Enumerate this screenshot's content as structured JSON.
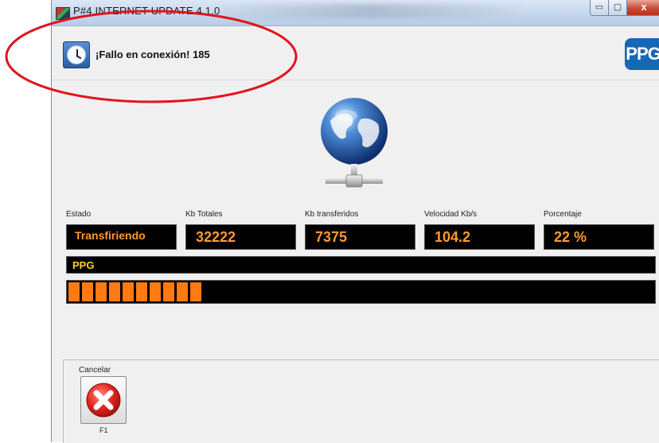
{
  "window": {
    "title": "P#4 INTERNET UPDATE 4.1.0",
    "controls": {
      "minimize": "▭",
      "maximize": "▢",
      "close": "x"
    }
  },
  "status": {
    "message": "¡Fallo en conexión! 185",
    "icon": "clock-icon"
  },
  "brand": {
    "logo_text": "PPG",
    "color": "#1667b5"
  },
  "fields": {
    "estado": {
      "label": "Estado",
      "value": "Transfiriendo"
    },
    "kb_totales": {
      "label": "Kb Totales",
      "value": "32222"
    },
    "kb_transferidos": {
      "label": "Kb transferidos",
      "value": "7375"
    },
    "velocidad": {
      "label": "Velocidad Kb/s",
      "value": "104.2"
    },
    "porcentaje": {
      "label": "Porcentaje",
      "value": "22 %"
    }
  },
  "current_item": "PPG",
  "progress": {
    "fraction": 0.22,
    "segment_color": "#ff7a10"
  },
  "actions": {
    "cancel": {
      "label": "Cancelar",
      "shortcut": "F1"
    }
  },
  "colors": {
    "value_text": "#ff9a2e",
    "item_text": "#ffd21f",
    "annotation": "#e0141b"
  }
}
